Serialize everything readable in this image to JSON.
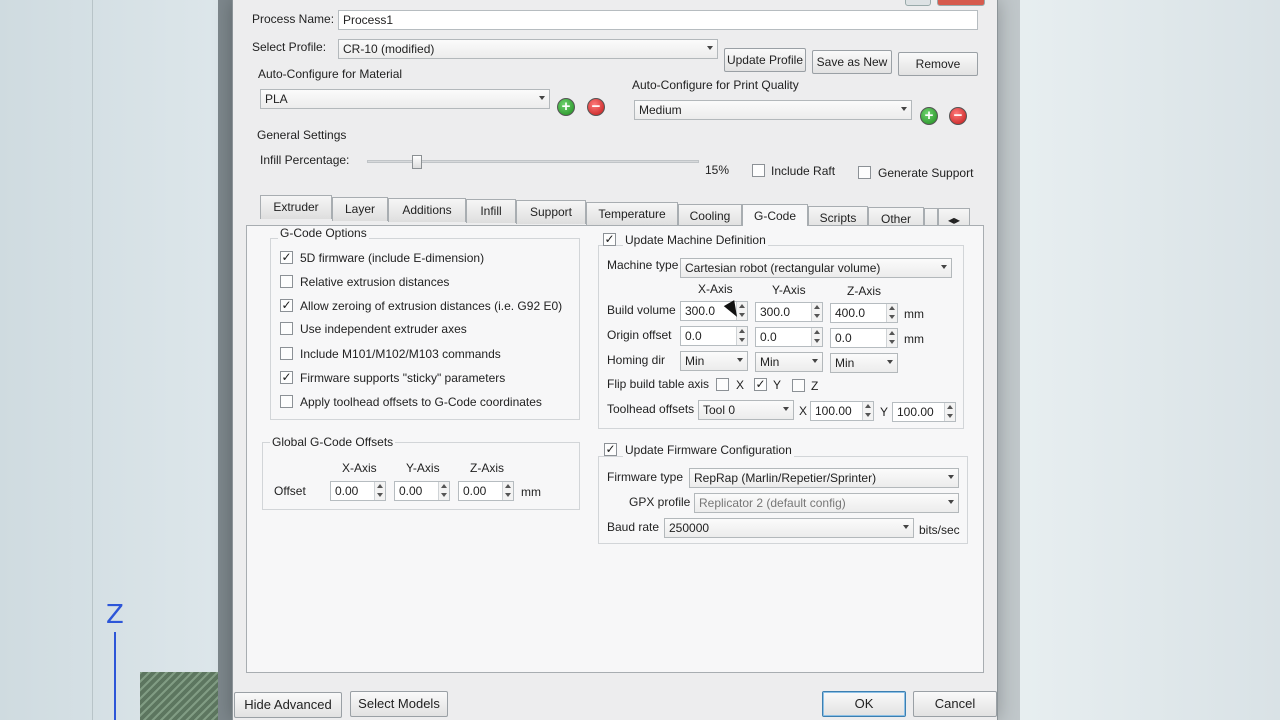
{
  "process": {
    "name_label": "Process Name:",
    "name_value": "Process1"
  },
  "profile": {
    "label": "Select Profile:",
    "value": "CR-10 (modified)",
    "update_btn": "Update Profile",
    "save_new_btn": "Save as New",
    "remove_btn": "Remove"
  },
  "material": {
    "label": "Auto-Configure for Material",
    "value": "PLA"
  },
  "quality": {
    "label": "Auto-Configure for Print Quality",
    "value": "Medium"
  },
  "general": {
    "label": "General Settings",
    "infill_label": "Infill Percentage:",
    "infill_value": "15%",
    "infill_fraction": 0.15,
    "raft_label": "Include Raft",
    "support_label": "Generate Support"
  },
  "tabs": [
    {
      "label": "Extruder"
    },
    {
      "label": "Layer"
    },
    {
      "label": "Additions"
    },
    {
      "label": "Infill"
    },
    {
      "label": "Support"
    },
    {
      "label": "Temperature"
    },
    {
      "label": "Cooling"
    },
    {
      "label": "G-Code"
    },
    {
      "label": "Scripts"
    },
    {
      "label": "Other"
    }
  ],
  "gcode_options": {
    "title": "G-Code Options",
    "items": [
      {
        "label": "5D firmware (include E-dimension)",
        "checked": true
      },
      {
        "label": "Relative extrusion distances",
        "checked": false
      },
      {
        "label": "Allow zeroing of extrusion distances (i.e. G92 E0)",
        "checked": true
      },
      {
        "label": "Use independent extruder axes",
        "checked": false
      },
      {
        "label": "Include M101/M102/M103 commands",
        "checked": false
      },
      {
        "label": "Firmware supports \"sticky\" parameters",
        "checked": true
      },
      {
        "label": "Apply toolhead offsets to G-Code coordinates",
        "checked": false
      }
    ]
  },
  "global_offsets": {
    "title": "Global G-Code Offsets",
    "x_axis": "X-Axis",
    "y_axis": "Y-Axis",
    "z_axis": "Z-Axis",
    "offset_label": "Offset",
    "x": "0.00",
    "y": "0.00",
    "z": "0.00",
    "unit": "mm"
  },
  "machine": {
    "update_label": "Update Machine Definition",
    "type_label": "Machine type",
    "type_value": "Cartesian robot (rectangular volume)",
    "x_axis": "X-Axis",
    "y_axis": "Y-Axis",
    "z_axis": "Z-Axis",
    "build_label": "Build volume",
    "build_x": "300.0",
    "build_y": "300.0",
    "build_z": "400.0",
    "origin_label": "Origin offset",
    "origin_x": "0.0",
    "origin_y": "0.0",
    "origin_z": "0.0",
    "unit": "mm",
    "homing_label": "Homing dir",
    "homing_x": "Min",
    "homing_y": "Min",
    "homing_z": "Min",
    "flip_label": "Flip build table axis",
    "flip_x": "X",
    "flip_y": "Y",
    "flip_z": "Z",
    "toolhead_label": "Toolhead offsets",
    "tool_value": "Tool 0",
    "tool_x_label": "X",
    "tool_x": "100.00",
    "tool_y_label": "Y",
    "tool_y": "100.00"
  },
  "firmware": {
    "update_label": "Update Firmware Configuration",
    "type_label": "Firmware type",
    "type_value": "RepRap (Marlin/Repetier/Sprinter)",
    "gpx_label": "GPX profile",
    "gpx_value": "Replicator 2 (default config)",
    "baud_label": "Baud rate",
    "baud_value": "250000",
    "baud_unit": "bits/sec"
  },
  "footer": {
    "hide_advanced": "Hide Advanced",
    "select_models": "Select Models",
    "ok": "OK",
    "cancel": "Cancel"
  },
  "background": {
    "axis_label": "Z"
  }
}
